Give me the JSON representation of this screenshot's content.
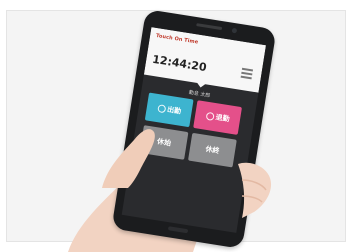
{
  "app": {
    "brand": "Touch On Time",
    "company": "",
    "date": "",
    "time": "12:44:20"
  },
  "user": {
    "name": "勤怠 太郎"
  },
  "buttons": {
    "clock_in": "出勤",
    "clock_out": "退勤",
    "break_start": "休始",
    "break_end": "休終"
  },
  "colors": {
    "clock_in": "#3db4cf",
    "clock_out": "#e4508a",
    "break": "#8d8e90"
  }
}
